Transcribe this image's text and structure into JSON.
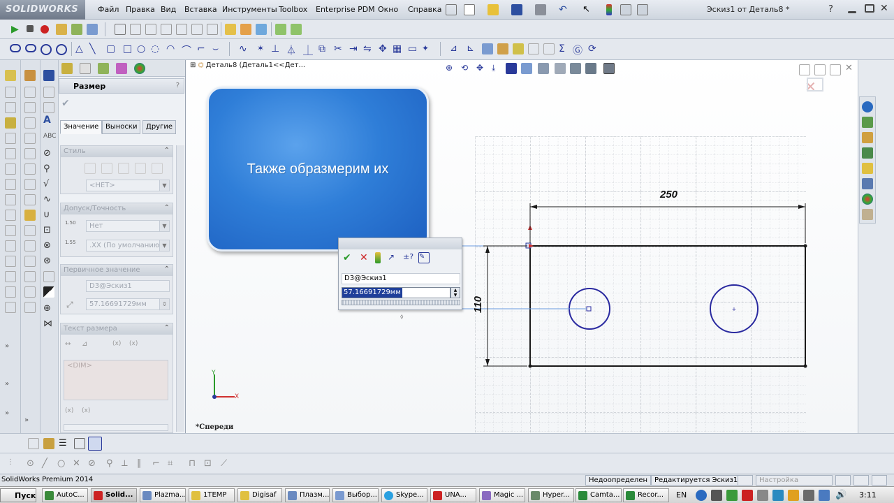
{
  "app": {
    "logo": "SOLIDWORKS",
    "document_title": "Эскиз1 от Деталь8 *"
  },
  "menu": [
    "Файл",
    "Правка",
    "Вид",
    "Вставка",
    "Инструменты",
    "Toolbox",
    "Enterprise PDM",
    "Окно",
    "Справка"
  ],
  "tree": {
    "part_label": "Деталь8  (Деталь1<<Дет..."
  },
  "property_manager": {
    "title": "Размер",
    "help": "?",
    "tabs": [
      "Значение",
      "Выноски",
      "Другие"
    ],
    "groups": {
      "style": {
        "title": "Стиль",
        "dropdown": "<НЕТ>"
      },
      "tolerance": {
        "title": "Допуск/Точность",
        "tolerance_type": "Нет",
        "precision": ".XX (По умолчанию)"
      },
      "primary_value": {
        "title": "Первичное значение",
        "name": "D3@Эскиз1",
        "value": "57.16691729мм"
      },
      "dimension_text": {
        "title": "Текст размера",
        "text": "<DIM>"
      }
    }
  },
  "callout": {
    "text": "Также образмерим их"
  },
  "modify_dialog": {
    "dimension_name": "D3@Эскиз1",
    "value": "57.16691729мм"
  },
  "drawing": {
    "width_label": "250",
    "height_label": "110"
  },
  "view_label": "*Спереди",
  "status_bar": {
    "product": "SolidWorks Premium 2014",
    "definition": "Недоопределен",
    "editing": "Редактируется Эскиз1",
    "customize": "Настройка"
  },
  "taskbar": {
    "start": "Пуск",
    "tasks": [
      "AutoC...",
      "Solid...",
      "Plazma...",
      "1TEMP",
      "Digisaf",
      "Плазм...",
      "Выбор...",
      "Skype...",
      "UNA...",
      "Magic ...",
      "Hyper...",
      "Camta...",
      "Recor..."
    ],
    "language": "EN",
    "clock": "3:11"
  },
  "colors": {
    "callout_blue": "#2f7ed8",
    "sketch_line": "#1a1a1a",
    "circle": "#2a2aa0",
    "highlight": "#1f3f9a"
  }
}
